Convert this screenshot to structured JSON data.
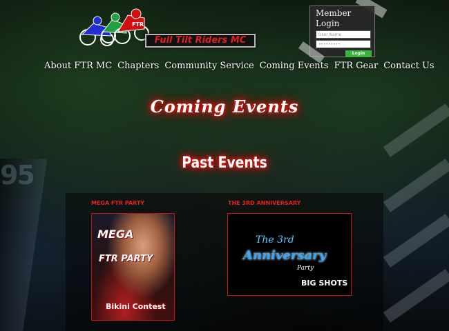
{
  "logo": {
    "text": "Full Tilt Riders MC"
  },
  "login": {
    "title_line1": "Member",
    "title_line2": "Login",
    "username_placeholder": "User Name",
    "password_value": "•••••••••",
    "button_label": "Login"
  },
  "nav": {
    "items": [
      {
        "label": "About FTR MC"
      },
      {
        "label": "Chapters"
      },
      {
        "label": "Community Service"
      },
      {
        "label": "Coming Events"
      },
      {
        "label": "FTR Gear"
      },
      {
        "label": "Contact Us"
      }
    ]
  },
  "main": {
    "title": "Coming Events",
    "past_title": "Past Events",
    "events": [
      {
        "label": "MEGA FTR PARTY",
        "flyer_heading": "MEGA",
        "flyer_sub": "FTR PARTY",
        "flyer_footer": "Bikini Contest"
      },
      {
        "label": "THE 3RD ANNIVERSARY",
        "flyer_heading": "The 3rd",
        "flyer_sub": "Anniversary",
        "flyer_party": "Party",
        "flyer_footer": "BIG SHOTS"
      }
    ]
  },
  "colors": {
    "accent_red": "#e82020",
    "glow_red": "#ff0000",
    "login_green": "#3bb33b"
  }
}
